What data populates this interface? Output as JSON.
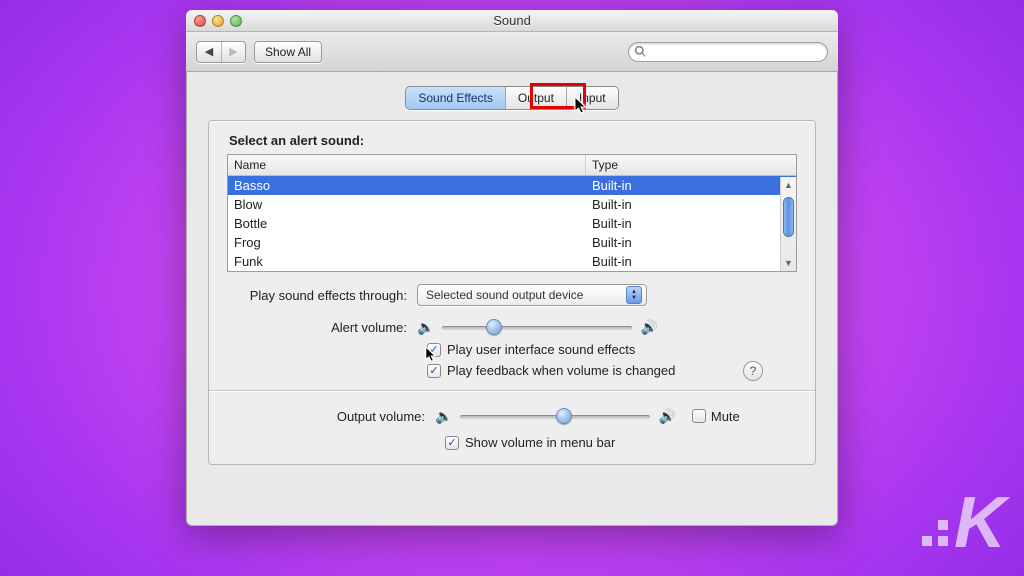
{
  "window": {
    "title": "Sound"
  },
  "toolbar": {
    "back_enabled": true,
    "forward_enabled": false,
    "show_all_label": "Show All",
    "search_placeholder": ""
  },
  "tabs": {
    "items": [
      {
        "label": "Sound Effects",
        "active": true
      },
      {
        "label": "Output",
        "active": false
      },
      {
        "label": "Input",
        "active": false
      }
    ],
    "highlighted_index": 1
  },
  "alert_sounds": {
    "heading": "Select an alert sound:",
    "columns": {
      "name": "Name",
      "type": "Type"
    },
    "rows": [
      {
        "name": "Basso",
        "type": "Built-in",
        "selected": true
      },
      {
        "name": "Blow",
        "type": "Built-in",
        "selected": false
      },
      {
        "name": "Bottle",
        "type": "Built-in",
        "selected": false
      },
      {
        "name": "Frog",
        "type": "Built-in",
        "selected": false
      },
      {
        "name": "Funk",
        "type": "Built-in",
        "selected": false
      }
    ]
  },
  "effects_output": {
    "label": "Play sound effects through:",
    "value": "Selected sound output device"
  },
  "alert_volume": {
    "label": "Alert volume:",
    "percent": 25
  },
  "checks": {
    "ui_sounds": {
      "label": "Play user interface sound effects",
      "checked": true
    },
    "vol_feedback": {
      "label": "Play feedback when volume is changed",
      "checked": true
    }
  },
  "help_label": "?",
  "output_volume": {
    "label": "Output volume:",
    "percent": 55,
    "mute": {
      "label": "Mute",
      "checked": false
    }
  },
  "menubar_check": {
    "label": "Show volume in menu bar",
    "checked": true
  },
  "watermark": "K"
}
